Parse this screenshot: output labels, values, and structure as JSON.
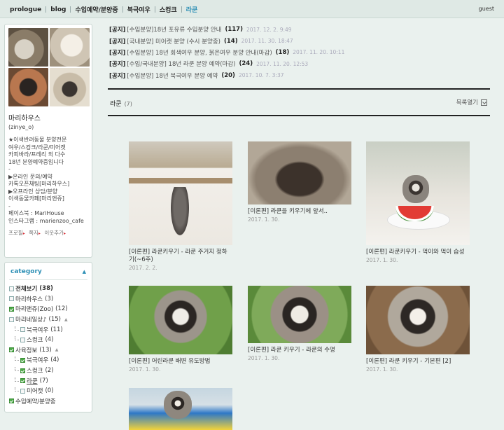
{
  "nav": {
    "items": [
      {
        "label": "prologue",
        "active": false
      },
      {
        "label": "blog",
        "active": false
      },
      {
        "label": "수입예약/분양중",
        "active": false
      },
      {
        "label": "북극여우",
        "active": false
      },
      {
        "label": "스컹크",
        "active": false
      },
      {
        "label": "라쿤",
        "active": true
      }
    ],
    "user": "guest"
  },
  "profile": {
    "name": "마리하우스",
    "id": "(zinye_o)",
    "intro": "★이색반려동물 분양전문\n여우/스컹크/라쿤/미어캣\n카피바라/프레리 외 다수\n18년 분양예약중입니다\n-\n▶온라인 문의/예약\n카톡오픈채팅[마리하우스]\n▶오프라인 상담/분양\n이색동물카페[마리앤쥬]\n-\n페이스북 : MariHouse\n인스타그램 : marienzoo_cafe",
    "links": [
      "프로필",
      "쪽지",
      "이웃추가"
    ],
    "photo_icons": [
      "fox-photo-icon",
      "dog-photo-icon",
      "fox-kit-photo-icon",
      "raccoon-photo-icon"
    ]
  },
  "category": {
    "title": "category",
    "items": [
      {
        "name": "전체보기",
        "count": "(38)",
        "level": 0,
        "checked": false,
        "bold": true
      },
      {
        "name": "마리하우스",
        "count": "(3)",
        "level": 0,
        "checked": false
      },
      {
        "name": "마리앤쥬(Zoo)",
        "count": "(12)",
        "level": 0,
        "checked": true
      },
      {
        "name": "마리네일상♪",
        "count": "(15)",
        "level": 0,
        "checked": false,
        "expanded": true
      },
      {
        "name": "북극여우",
        "count": "(11)",
        "level": 1,
        "checked": false
      },
      {
        "name": "스컹크",
        "count": "(4)",
        "level": 1,
        "checked": false
      },
      {
        "name": "사육정보",
        "count": "(13)",
        "level": 0,
        "checked": true,
        "expanded": true
      },
      {
        "name": "북극여우",
        "count": "(4)",
        "level": 1,
        "checked": true
      },
      {
        "name": "스컹크",
        "count": "(2)",
        "level": 1,
        "checked": true
      },
      {
        "name": "라쿤",
        "count": "(7)",
        "level": 1,
        "checked": true,
        "current": true
      },
      {
        "name": "미어캣",
        "count": "(0)",
        "level": 1,
        "checked": false
      },
      {
        "name": "수입예약/분양중",
        "count": "",
        "level": 0,
        "checked": true
      }
    ]
  },
  "notices": [
    {
      "tag": "[공지]",
      "title": "[수입분양]18년 포유류 수입분양 안내",
      "count": "(117)",
      "date": "2017. 12. 2. 9:49"
    },
    {
      "tag": "[공지]",
      "title": "[국내분양] 미어캣 분양 (수시 분양중)",
      "count": "(14)",
      "date": "2017. 11. 30. 18:47"
    },
    {
      "tag": "[공지]",
      "title": "[수입분양] 18년 회색여우 분양, 붉은여우 분양 안내(마감)",
      "count": "(18)",
      "date": "2017. 11. 20. 10:11"
    },
    {
      "tag": "[공지]",
      "title": "[수입/국내분양] 18년 라쿤 분양 예약(마감)",
      "count": "(24)",
      "date": "2017. 11. 20. 12:53"
    },
    {
      "tag": "[공지]",
      "title": "[수입분양] 18년 북극여우 분양 예약",
      "count": "(20)",
      "date": "2017. 10. 7. 3:37"
    }
  ],
  "category_bar": {
    "title": "라쿤",
    "count": "(7)",
    "toggle": "목록열기"
  },
  "posts": [
    {
      "title": "[이론편] 라쿤키우기 - 라쿤 주거지 정하기(~6주)",
      "date": "2017. 2. 2."
    },
    {
      "title": "[이론편] 라쿤을 키우기에 앞서..",
      "date": "2017. 1. 30."
    },
    {
      "title": "[이론편] 라쿤키우기 - 먹이와 먹이 습성",
      "date": "2017. 1. 30."
    },
    {
      "title": "[이론편] 어린라쿤 배변 유도방법",
      "date": "2017. 1. 30."
    },
    {
      "title": "[이론편] 라쿤 키우기 - 라쿤의 수명",
      "date": "2017. 1. 30."
    },
    {
      "title": "[이론편] 라쿤 키우기 - 기본편 [2]",
      "date": "2017. 1. 30."
    },
    {
      "title": "",
      "date": ""
    }
  ]
}
